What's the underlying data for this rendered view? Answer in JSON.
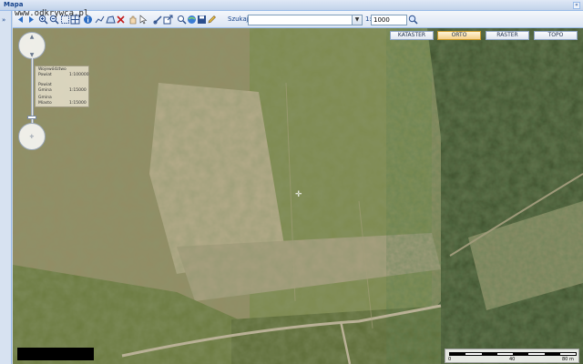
{
  "window": {
    "title": "Mapa",
    "collapse_glyph": "«",
    "expand_glyph": "»"
  },
  "watermark": "www.odkrywca.pl",
  "toolbar": {
    "icons": [
      "back-icon",
      "forward-icon",
      "zoom-in-icon",
      "zoom-out-icon",
      "zoom-extent-icon",
      "grid-icon",
      "info-icon",
      "measure-line-icon",
      "measure-area-icon",
      "clear-icon",
      "pan-icon",
      "select-icon",
      "link-icon",
      "export-icon",
      "search-map-icon",
      "layers-icon",
      "save-icon",
      "pencil-icon"
    ],
    "search_label": "Szukaj:",
    "search_value": "",
    "scale_prefix": "1:",
    "scale_value": "1000"
  },
  "layers": [
    {
      "label": "KATASTER",
      "active": false
    },
    {
      "label": "ORTO",
      "active": true
    },
    {
      "label": "RASTER",
      "active": false
    },
    {
      "label": "TOPO",
      "active": false
    }
  ],
  "zoom_levels": [
    {
      "name": "Województwo",
      "scale": ""
    },
    {
      "name": "Powiat",
      "scale": "1:100000"
    },
    {
      "name": "Powiat",
      "scale": ""
    },
    {
      "name": "Gmina",
      "scale": "1:15000"
    },
    {
      "name": "Gmina",
      "scale": ""
    },
    {
      "name": "Miasto",
      "scale": "1:15000"
    }
  ],
  "scalebar": {
    "labels": [
      "0",
      "40",
      "80 m"
    ],
    "segments": 8
  },
  "colors": {
    "accent": "#15428b",
    "active_layer": "#f5d08a"
  }
}
